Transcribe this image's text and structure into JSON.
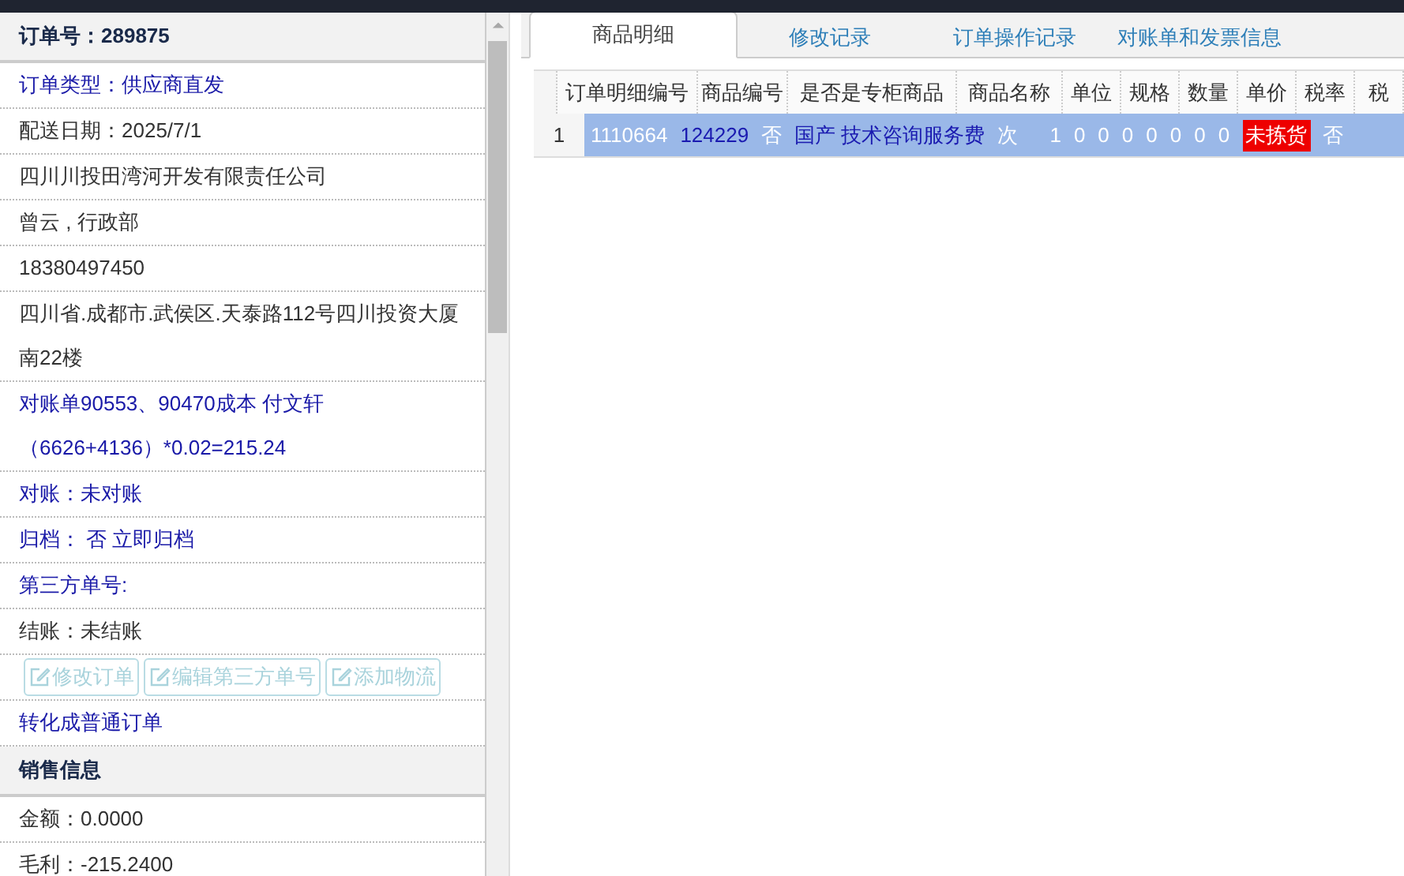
{
  "order_header": {
    "label": "订单号：",
    "value": "289875"
  },
  "details": [
    {
      "kind": "link",
      "lines": [
        "订单类型：供应商直发"
      ]
    },
    {
      "kind": "text",
      "lines": [
        "配送日期：2025/7/1"
      ]
    },
    {
      "kind": "text",
      "lines": [
        "四川川投田湾河开发有限责任公司"
      ]
    },
    {
      "kind": "text",
      "lines": [
        "曾云 , 行政部"
      ]
    },
    {
      "kind": "text",
      "lines": [
        "18380497450"
      ]
    },
    {
      "kind": "text",
      "lines": [
        "四川省.成都市.武侯区.天泰路112号四川投资大厦",
        "南22楼"
      ]
    },
    {
      "kind": "link",
      "lines": [
        "对账单90553、90470成本 付文轩",
        "（6626+4136）*0.02=215.24"
      ]
    },
    {
      "kind": "link",
      "lines": [
        "对账：未对账"
      ]
    },
    {
      "kind": "link",
      "lines": [
        "归档： 否 立即归档"
      ]
    },
    {
      "kind": "link",
      "lines": [
        "第三方单号:"
      ]
    },
    {
      "kind": "text",
      "lines": [
        "结账：未结账"
      ]
    }
  ],
  "actions": [
    {
      "label": "修改订单",
      "disabled": true
    },
    {
      "label": "编辑第三方单号",
      "disabled": true
    },
    {
      "label": "添加物流",
      "disabled": true
    }
  ],
  "convert_link": "转化成普通订单",
  "sales_header": "销售信息",
  "sales": [
    "金额：0.0000",
    "毛利：-215.2400"
  ],
  "tabs": [
    {
      "label": "商品明细",
      "selected": true
    },
    {
      "label": "修改记录",
      "selected": false
    },
    {
      "label": "订单操作记录",
      "selected": false
    },
    {
      "label": "对账单和发票信息",
      "selected": false
    }
  ],
  "detail_grid": {
    "header_labels": [
      "订单明细编号",
      "商品编号",
      "是否是专柜商品",
      "商品名称",
      "单位",
      "规格",
      "数量",
      "单价",
      "税率",
      "税"
    ],
    "lines": [
      {
        "index": "1",
        "selected": true,
        "values": [
          {
            "kind": "text",
            "text": "1110664"
          },
          {
            "kind": "link",
            "text": "124229"
          },
          {
            "kind": "text",
            "text": "否"
          },
          {
            "kind": "link",
            "text": "国产 技术咨询服务费"
          },
          {
            "kind": "text",
            "text": "次"
          },
          {
            "kind": "num",
            "text": "1"
          },
          {
            "kind": "text",
            "text": "0"
          },
          {
            "kind": "text",
            "text": "0"
          },
          {
            "kind": "text",
            "text": "0"
          },
          {
            "kind": "text",
            "text": "0"
          },
          {
            "kind": "text",
            "text": "0"
          },
          {
            "kind": "text",
            "text": "0"
          },
          {
            "kind": "text",
            "text": "0"
          },
          {
            "kind": "alert",
            "text": "未拣货"
          },
          {
            "kind": "text",
            "text": "否"
          }
        ]
      }
    ]
  }
}
